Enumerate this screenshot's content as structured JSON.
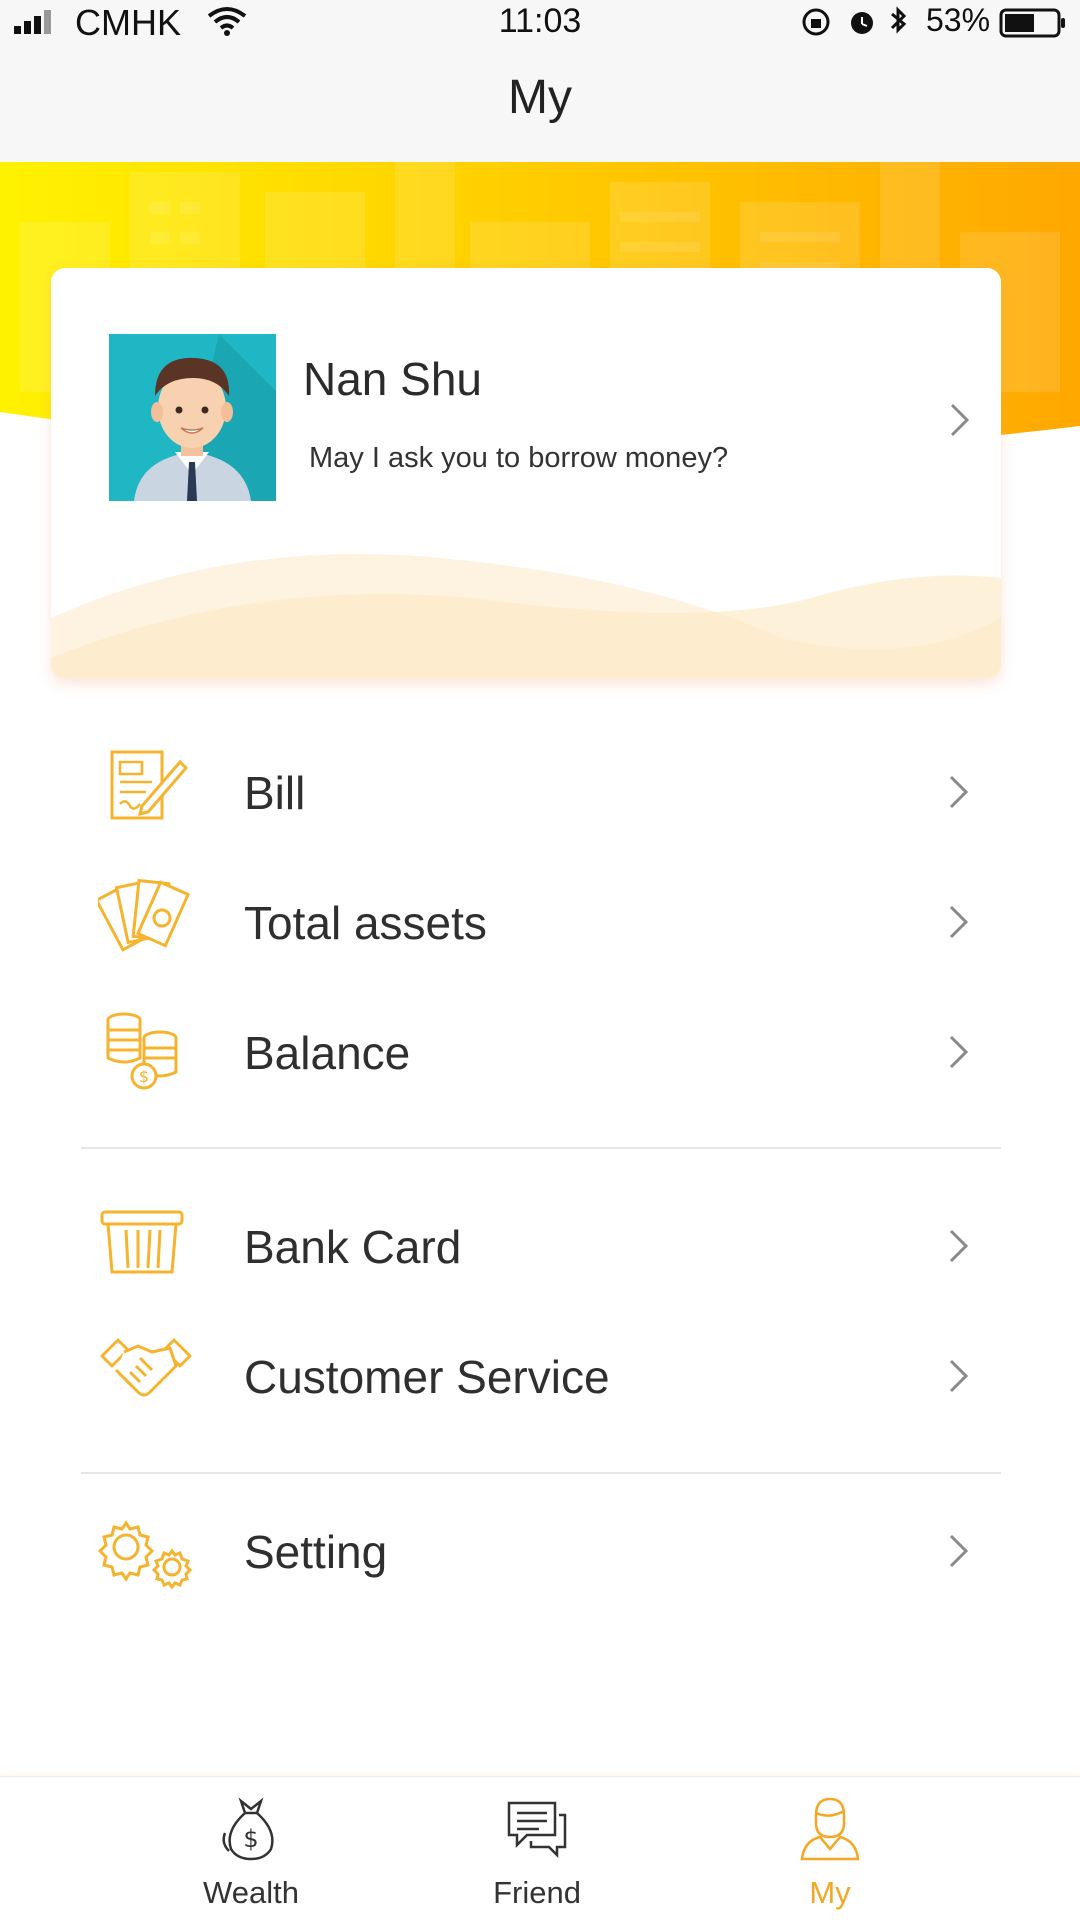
{
  "status_bar": {
    "carrier": "CMHK",
    "time": "11:03",
    "battery": "53%"
  },
  "nav": {
    "title": "My"
  },
  "profile": {
    "name": "Nan Shu",
    "motto": "May I ask you to borrow money?"
  },
  "menu": {
    "bill": "Bill",
    "total_assets": "Total assets",
    "balance": "Balance",
    "bank_card": "Bank Card",
    "customer_service": "Customer Service",
    "setting": "Setting"
  },
  "tabbar": {
    "wealth": "Wealth",
    "friend": "Friend",
    "my": "My"
  },
  "colors": {
    "accent": "#f5a623",
    "banner_left": "#ffe400",
    "banner_right": "#ffa600"
  },
  "icons": {
    "bill": "bill-icon",
    "total_assets": "cash-fan-icon",
    "balance": "coins-icon",
    "bank_card": "bank-card-icon",
    "customer_service": "handshake-icon",
    "setting": "gears-icon",
    "wealth": "money-bag-icon",
    "friend": "chat-bubbles-icon",
    "my": "person-icon"
  }
}
